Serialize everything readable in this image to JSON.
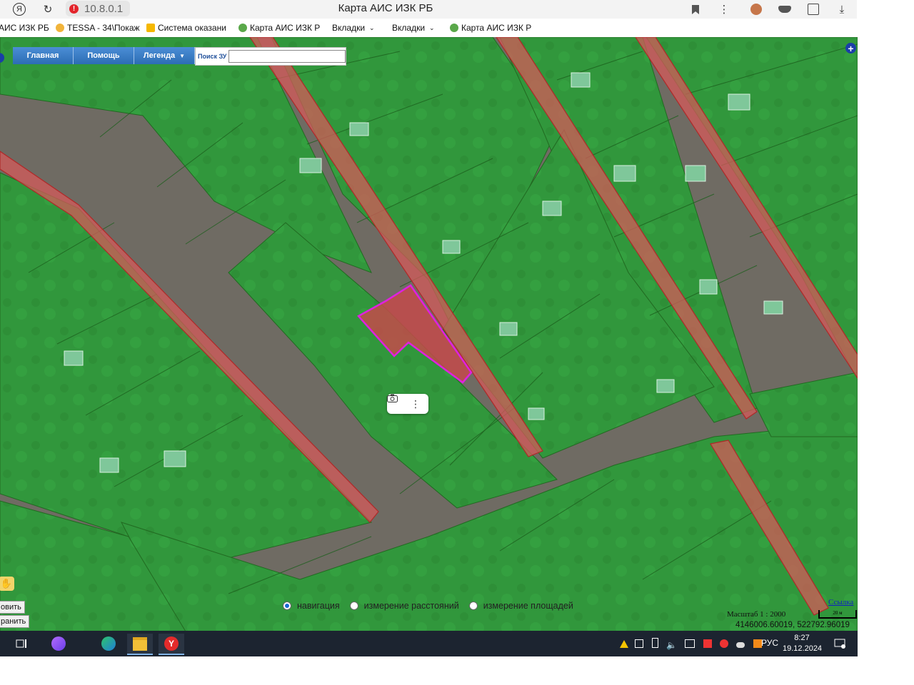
{
  "browser": {
    "url": "10.8.0.1",
    "window_title": "Карта АИС ИЗК РБ",
    "bookmarks": [
      {
        "label": "АИС ИЗК РБ"
      },
      {
        "label": "TESSA - 34\\Покаж"
      },
      {
        "label": "Система оказани"
      },
      {
        "label": "Карта АИС ИЗК Р"
      },
      {
        "label": "Вкладки"
      },
      {
        "label": "Вкладки"
      },
      {
        "label": "Карта АИС ИЗК Р"
      }
    ]
  },
  "toolbar": {
    "main_label": "Главная",
    "help_label": "Помощь",
    "legend_label": "Легенда",
    "search_label": "Поиск ЗУ",
    "search_value": ""
  },
  "side_buttons": {
    "save_label": "овить",
    "store_label": "ранить"
  },
  "modes": [
    {
      "label": "навигация",
      "selected": true
    },
    {
      "label": "измерение расстояний",
      "selected": false
    },
    {
      "label": "измерение площадей",
      "selected": false
    }
  ],
  "map_info": {
    "link_label": "Ссылка",
    "scale_label": "Масштаб 1 : 2000",
    "scale_bar_label": "20 м",
    "coordinates": "4146006.60019, 522792.96019"
  },
  "taskbar": {
    "language": "РУС",
    "time": "8:27",
    "date": "19.12.2024"
  },
  "colors": {
    "parcel_fill": "#3fbf4a",
    "road_fill": "#e06060",
    "selected_parcel": "#d020d8",
    "toolbar_blue": "#3479c6"
  }
}
